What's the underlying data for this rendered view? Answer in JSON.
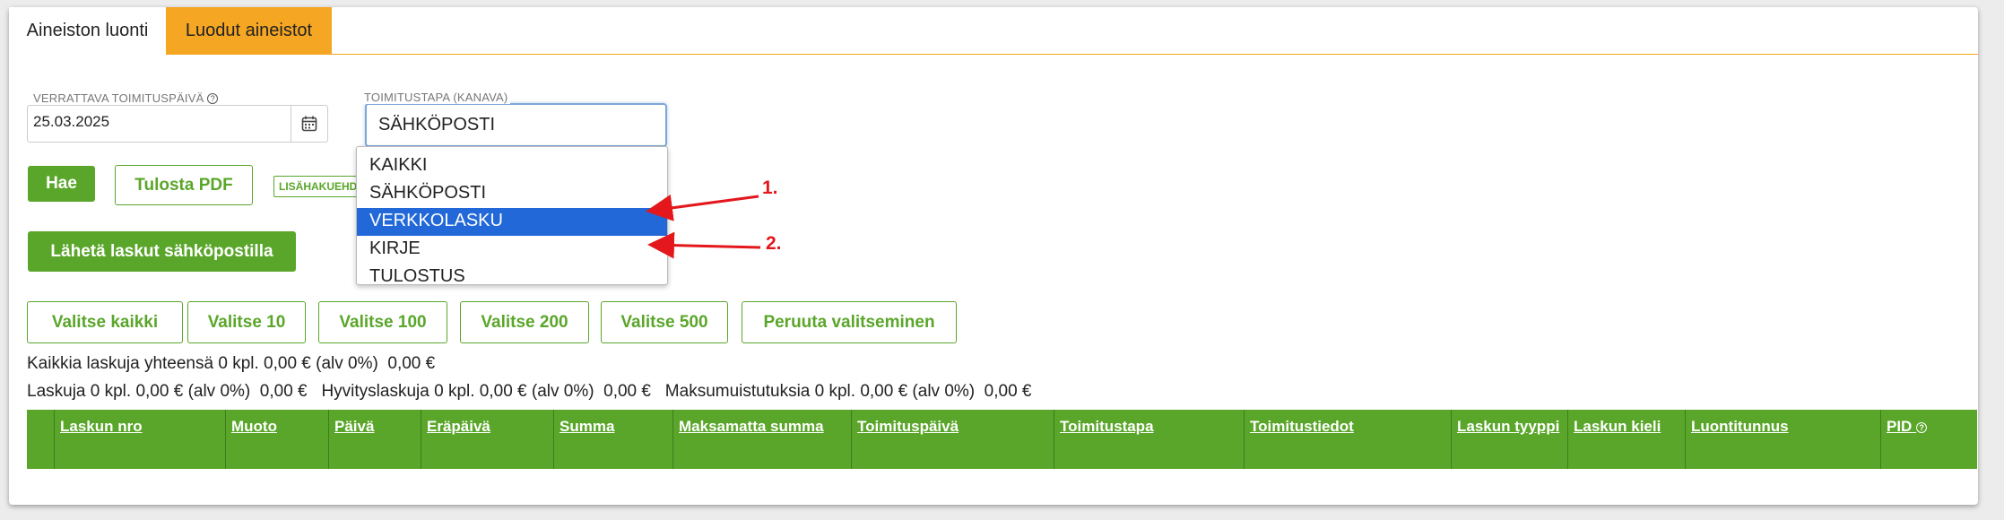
{
  "tabs": [
    {
      "label": "Aineiston luonti",
      "active": true
    },
    {
      "label": "Luodut aineistot",
      "active": false
    }
  ],
  "filters": {
    "date_label": "VERRATTAVA TOIMITUSPÄIVÄ",
    "date_value": "25.03.2025",
    "channel_label": "TOIMITUSTAPA (KANAVA)",
    "channel_value": "SÄHKÖPOSTI",
    "channel_options": [
      "KAIKKI",
      "SÄHKÖPOSTI",
      "VERKKOLASKU",
      "KIRJE",
      "TULOSTUS"
    ],
    "highlighted_option": "VERKKOLASKU"
  },
  "buttons": {
    "search": "Hae",
    "print_pdf": "Tulosta PDF",
    "extra_search": "LISÄHAKUEHDOT",
    "send_email": "Lähetä laskut sähköpostilla",
    "select": [
      "Valitse kaikki",
      "Valitse 10",
      "Valitse 100",
      "Valitse 200",
      "Valitse 500",
      "Peruuta valitseminen"
    ]
  },
  "summary": {
    "line1": "Kaikkia laskuja yhteensä 0 kpl. 0,00 € (alv 0%)  0,00 €",
    "line2": "Laskuja 0 kpl. 0,00 € (alv 0%)  0,00 €   Hyvityslaskuja 0 kpl. 0,00 € (alv 0%)  0,00 €   Maksumuistutuksia 0 kpl. 0,00 € (alv 0%)  0,00 €"
  },
  "table": {
    "columns": [
      "Laskun nro",
      "Muoto",
      "Päivä",
      "Eräpäivä",
      "Summa",
      "Maksamatta summa",
      "Toimituspäivä",
      "Toimitustapa",
      "Toimitustiedot",
      "Laskun tyyppi",
      "Laskun kieli",
      "Luontitunnus",
      "PID"
    ]
  },
  "annotations": [
    "1.",
    "2."
  ],
  "colors": {
    "accent": "#5aa62a",
    "tab_active": "#f5a623",
    "highlight": "#2268d8",
    "arrow": "#e3171c"
  }
}
